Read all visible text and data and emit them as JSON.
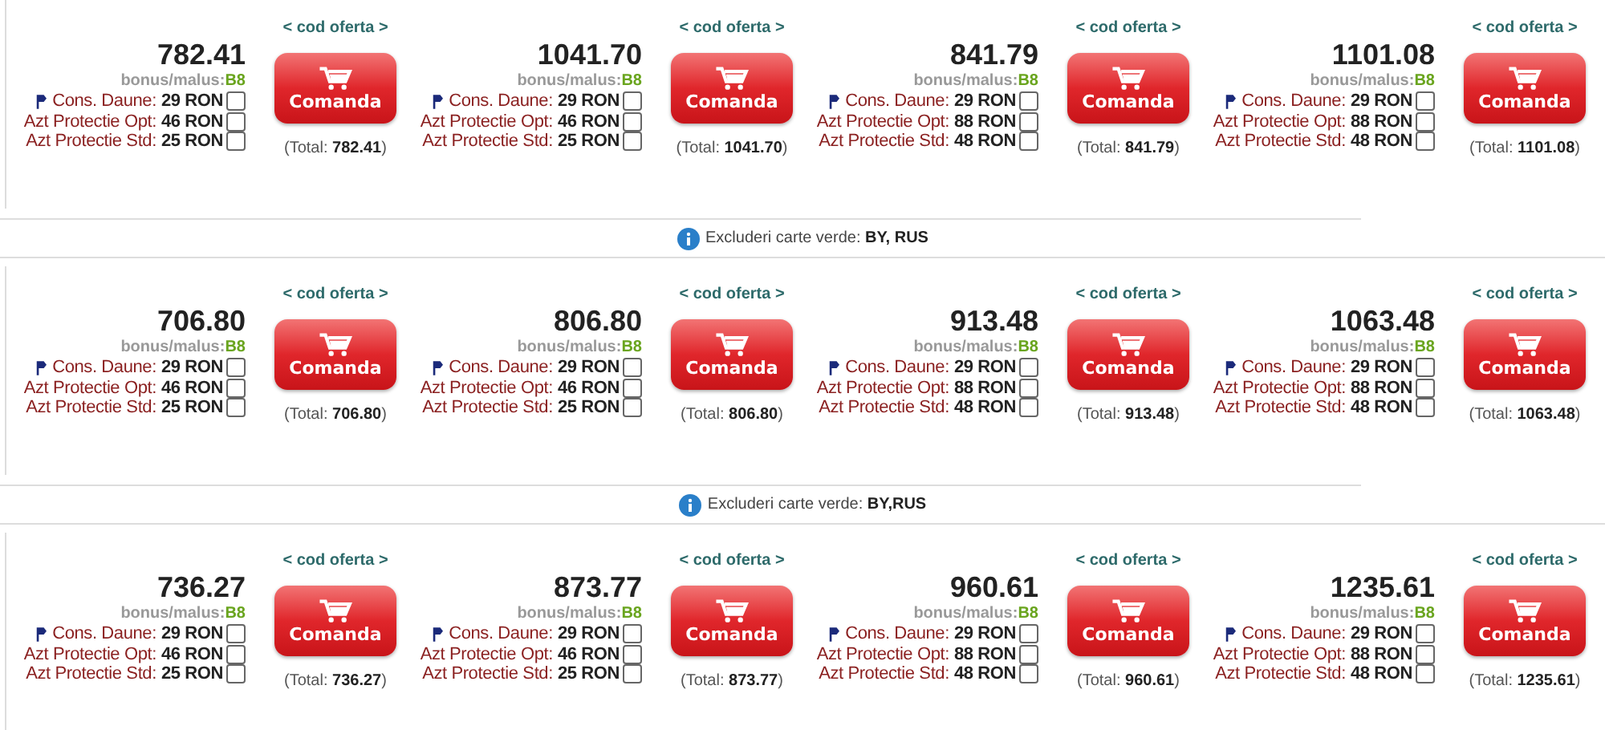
{
  "sections": [
    {
      "offers": [
        {
          "code_link": "< cod oferta >",
          "price": "782.41",
          "bonus_label": "bonus/malus:",
          "bonus_class": "B8",
          "options": [
            {
              "label": "Cons. Daune:",
              "price": "29 RON",
              "checked": false,
              "flag": true
            },
            {
              "label": "Azt Protectie Opt:",
              "price": "46 RON",
              "checked": false,
              "flag": false
            },
            {
              "label": "Azt Protectie Std:",
              "price": "25 RON",
              "checked": false,
              "flag": false
            }
          ],
          "button": "Comanda",
          "total": "(Total: **782.41**)"
        },
        {
          "code_link": "< cod oferta >",
          "price": "1041.70",
          "bonus_label": "bonus/malus:",
          "bonus_class": "B8",
          "options": [
            {
              "label": "Cons. Daune:",
              "price": "29 RON",
              "checked": false,
              "flag": true
            },
            {
              "label": "Azt Protectie Opt:",
              "price": "46 RON",
              "checked": false,
              "flag": false
            },
            {
              "label": "Azt Protectie Std:",
              "price": "25 RON",
              "checked": false,
              "flag": false
            }
          ],
          "button": "Comanda",
          "total": "(Total: **1041.70**)"
        },
        {
          "code_link": "< cod oferta >",
          "price": "841.79",
          "bonus_label": "bonus/malus:",
          "bonus_class": "B8",
          "options": [
            {
              "label": "Cons. Daune:",
              "price": "29 RON",
              "checked": false,
              "flag": true
            },
            {
              "label": "Azt Protectie Opt:",
              "price": "88 RON",
              "checked": false,
              "flag": false
            },
            {
              "label": "Azt Protectie Std:",
              "price": "48 RON",
              "checked": false,
              "flag": false
            }
          ],
          "button": "Comanda",
          "total": "(Total: **841.79**)"
        },
        {
          "code_link": "< cod oferta >",
          "price": "1101.08",
          "bonus_label": "bonus/malus:",
          "bonus_class": "B8",
          "options": [
            {
              "label": "Cons. Daune:",
              "price": "29 RON",
              "checked": false,
              "flag": true
            },
            {
              "label": "Azt Protectie Opt:",
              "price": "88 RON",
              "checked": false,
              "flag": false
            },
            {
              "label": "Azt Protectie Std:",
              "price": "48 RON",
              "checked": false,
              "flag": false
            }
          ],
          "button": "Comanda",
          "total": "(Total: **1101.08**)"
        }
      ],
      "exclusion": "Excluderi carte verde: **BY, RUS**"
    },
    {
      "offers": [
        {
          "code_link": "< cod oferta >",
          "price": "706.80",
          "bonus_label": "bonus/malus:",
          "bonus_class": "B8",
          "options": [
            {
              "label": "Cons. Daune:",
              "price": "29 RON",
              "checked": false,
              "flag": true
            },
            {
              "label": "Azt Protectie Opt:",
              "price": "46 RON",
              "checked": false,
              "flag": false
            },
            {
              "label": "Azt Protectie Std:",
              "price": "25 RON",
              "checked": false,
              "flag": false
            }
          ],
          "button": "Comanda",
          "total": "(Total: **706.80**)"
        },
        {
          "code_link": "< cod oferta >",
          "price": "806.80",
          "bonus_label": "bonus/malus:",
          "bonus_class": "B8",
          "options": [
            {
              "label": "Cons. Daune:",
              "price": "29 RON",
              "checked": false,
              "flag": true
            },
            {
              "label": "Azt Protectie Opt:",
              "price": "46 RON",
              "checked": false,
              "flag": false
            },
            {
              "label": "Azt Protectie Std:",
              "price": "25 RON",
              "checked": false,
              "flag": false
            }
          ],
          "button": "Comanda",
          "total": "(Total: **806.80**)"
        },
        {
          "code_link": "< cod oferta >",
          "price": "913.48",
          "bonus_label": "bonus/malus:",
          "bonus_class": "B8",
          "options": [
            {
              "label": "Cons. Daune:",
              "price": "29 RON",
              "checked": false,
              "flag": true
            },
            {
              "label": "Azt Protectie Opt:",
              "price": "88 RON",
              "checked": false,
              "flag": false
            },
            {
              "label": "Azt Protectie Std:",
              "price": "48 RON",
              "checked": false,
              "flag": false
            }
          ],
          "button": "Comanda",
          "total": "(Total: **913.48**)"
        },
        {
          "code_link": "< cod oferta >",
          "price": "1063.48",
          "bonus_label": "bonus/malus:",
          "bonus_class": "B8",
          "options": [
            {
              "label": "Cons. Daune:",
              "price": "29 RON",
              "checked": false,
              "flag": true
            },
            {
              "label": "Azt Protectie Opt:",
              "price": "88 RON",
              "checked": false,
              "flag": false
            },
            {
              "label": "Azt Protectie Std:",
              "price": "48 RON",
              "checked": false,
              "flag": false
            }
          ],
          "button": "Comanda",
          "total": "(Total: **1063.48**)"
        }
      ],
      "exclusion": "Excluderi carte verde: **BY,RUS**"
    },
    {
      "offers": [
        {
          "code_link": "< cod oferta >",
          "price": "736.27",
          "bonus_label": "bonus/malus:",
          "bonus_class": "B8",
          "options": [
            {
              "label": "Cons. Daune:",
              "price": "29 RON",
              "checked": false,
              "flag": true
            },
            {
              "label": "Azt Protectie Opt:",
              "price": "46 RON",
              "checked": false,
              "flag": false
            },
            {
              "label": "Azt Protectie Std:",
              "price": "25 RON",
              "checked": false,
              "flag": false
            }
          ],
          "button": "Comanda",
          "total": "(Total: **736.27**)"
        },
        {
          "code_link": "< cod oferta >",
          "price": "873.77",
          "bonus_label": "bonus/malus:",
          "bonus_class": "B8",
          "options": [
            {
              "label": "Cons. Daune:",
              "price": "29 RON",
              "checked": false,
              "flag": true
            },
            {
              "label": "Azt Protectie Opt:",
              "price": "46 RON",
              "checked": false,
              "flag": false
            },
            {
              "label": "Azt Protectie Std:",
              "price": "25 RON",
              "checked": false,
              "flag": false
            }
          ],
          "button": "Comanda",
          "total": "(Total: **873.77**)"
        },
        {
          "code_link": "< cod oferta >",
          "price": "960.61",
          "bonus_label": "bonus/malus:",
          "bonus_class": "B8",
          "options": [
            {
              "label": "Cons. Daune:",
              "price": "29 RON",
              "checked": false,
              "flag": true
            },
            {
              "label": "Azt Protectie Opt:",
              "price": "88 RON",
              "checked": false,
              "flag": false
            },
            {
              "label": "Azt Protectie Std:",
              "price": "48 RON",
              "checked": false,
              "flag": false
            }
          ],
          "button": "Comanda",
          "total": "(Total: **960.61**)"
        },
        {
          "code_link": "< cod oferta >",
          "price": "1235.61",
          "bonus_label": "bonus/malus:",
          "bonus_class": "B8",
          "options": [
            {
              "label": "Cons. Daune:",
              "price": "29 RON",
              "checked": false,
              "flag": true
            },
            {
              "label": "Azt Protectie Opt:",
              "price": "88 RON",
              "checked": false,
              "flag": false
            },
            {
              "label": "Azt Protectie Std:",
              "price": "48 RON",
              "checked": false,
              "flag": false
            }
          ],
          "button": "Comanda",
          "total": "(Total: **1235.61**)"
        }
      ]
    }
  ]
}
